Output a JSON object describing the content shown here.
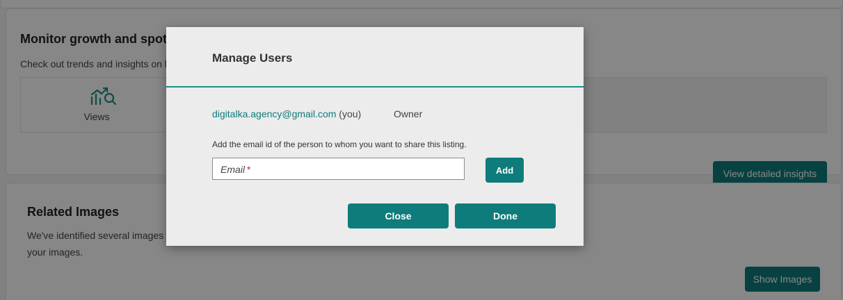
{
  "background": {
    "insights_card": {
      "title": "Monitor growth and spot",
      "description": "Check out trends and insights on h",
      "views_label": "Views",
      "views_icon": "trend-chart-icon",
      "button_label": "View detailed insights"
    },
    "images_card": {
      "title": "Related Images",
      "description_line1": "We've identified several images w",
      "description_line2": "your images.",
      "button_label": "Show Images"
    }
  },
  "dialog": {
    "title": "Manage Users",
    "users": [
      {
        "email": "digitalka.agency@gmail.com",
        "suffix": "(you)",
        "role": "Owner"
      }
    ],
    "share_hint": "Add the email id of the person to whom you want to share this listing.",
    "email_input": {
      "placeholder": "Email",
      "required_marker": "*",
      "value": ""
    },
    "add_label": "Add",
    "close_label": "Close",
    "done_label": "Done"
  },
  "colors": {
    "accent": "#0e7c7b",
    "header_rule": "#1a8f84",
    "required": "#c62828"
  }
}
